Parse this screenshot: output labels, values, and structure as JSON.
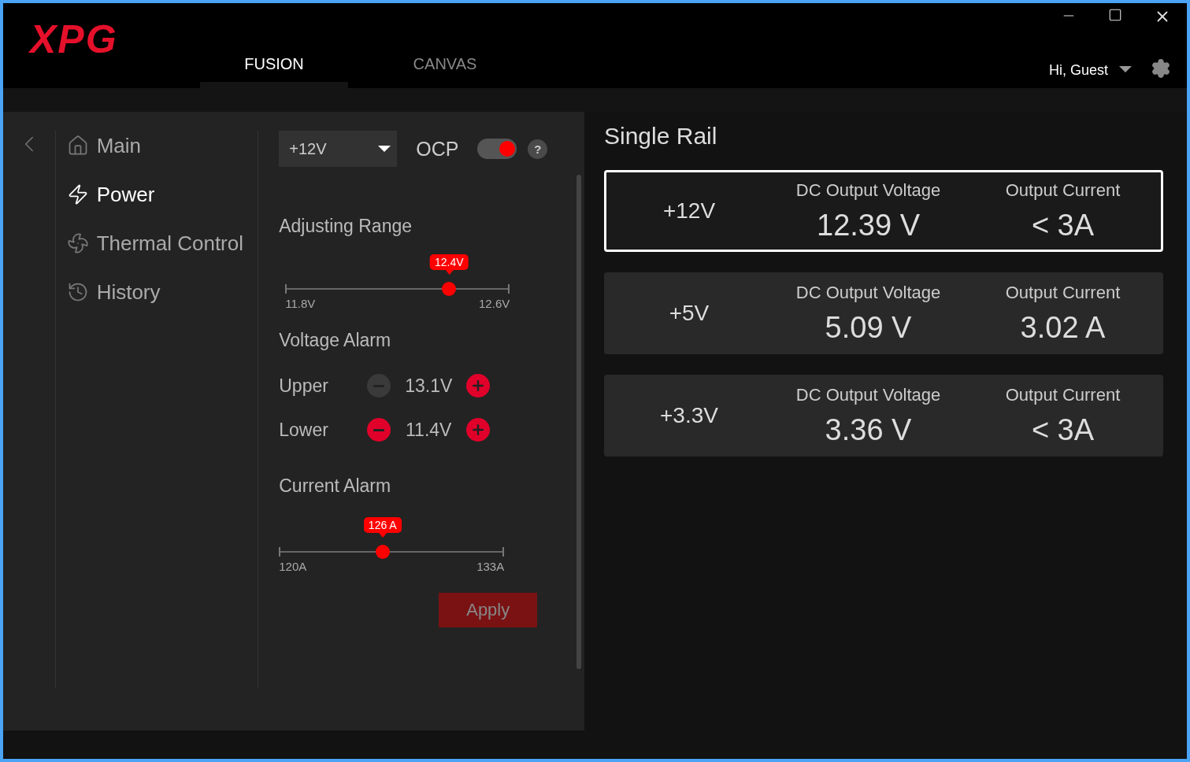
{
  "logo": "XPG",
  "tabs": [
    {
      "label": "FUSION",
      "selected": true
    },
    {
      "label": "CANVAS",
      "selected": false
    }
  ],
  "user": {
    "greeting": "Hi, Guest"
  },
  "sidebar": {
    "items": [
      {
        "label": "Main",
        "selected": false
      },
      {
        "label": "Power",
        "selected": true
      },
      {
        "label": "Thermal Control",
        "selected": false
      },
      {
        "label": "History",
        "selected": false
      }
    ]
  },
  "settings": {
    "rail_select": {
      "value": "+12V"
    },
    "ocp": {
      "label": "OCP",
      "on": true,
      "help": "?"
    },
    "adjusting_range": {
      "title": "Adjusting Range",
      "level": 0.73,
      "reading": "12.4V",
      "min": "11.8V",
      "max": "12.6V"
    },
    "voltage_alarm": {
      "title": "Voltage Alarm",
      "rows": [
        {
          "label": "Upper",
          "value": "13.1V",
          "minus_disabled": true,
          "plus_disabled": false
        },
        {
          "label": "Lower",
          "value": "11.4V",
          "minus_disabled": false,
          "plus_disabled": false
        }
      ]
    },
    "current_alarm": {
      "title": "Current Alarm",
      "level": 0.46,
      "reading": "126 A",
      "min": "120A",
      "max": "133A"
    },
    "apply": {
      "label": "Apply",
      "disabled": true
    }
  },
  "rails": {
    "title": "Single Rail",
    "cards": [
      {
        "rail": "+12V",
        "voltage_label": "DC Output Voltage",
        "voltage": "12.39 V",
        "current_label": "Output Current",
        "current": "< 3A",
        "selected": true
      },
      {
        "rail": "+5V",
        "voltage_label": "DC Output Voltage",
        "voltage": "5.09 V",
        "current_label": "Output Current",
        "current": "3.02 A",
        "selected": false
      },
      {
        "rail": "+3.3V",
        "voltage_label": "DC Output Voltage",
        "voltage": "3.36 V",
        "current_label": "Output Current",
        "current": "< 3A",
        "selected": false
      }
    ]
  }
}
